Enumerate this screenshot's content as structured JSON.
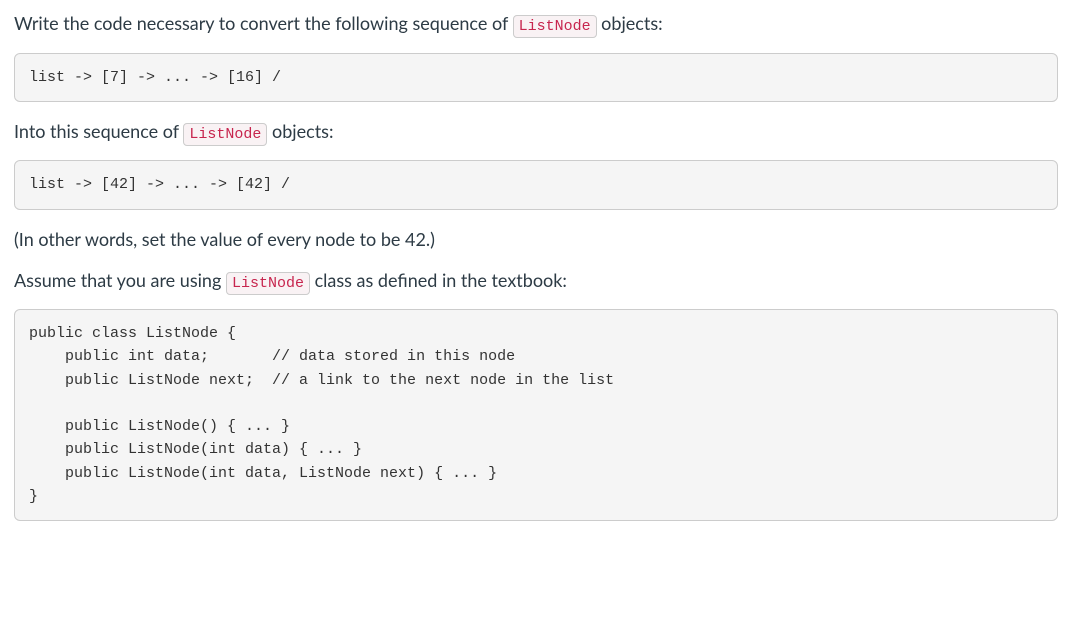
{
  "intro": {
    "part1": "Write the code necessary to convert the following sequence of ",
    "code": "ListNode",
    "part2": " objects:"
  },
  "codeblock1": "list -> [7] -> ... -> [16] /",
  "mid1": {
    "part1": "Into this sequence of ",
    "code": "ListNode",
    "part2": " objects:"
  },
  "codeblock2": "list -> [42] -> ... -> [42] /",
  "note": "(In other words, set the value of every node to be 42.)",
  "assume": {
    "part1": "Assume that you are using ",
    "code": "ListNode",
    "part2": " class as defined in the textbook:"
  },
  "classdef": "public class ListNode {\n    public int data;       // data stored in this node\n    public ListNode next;  // a link to the next node in the list\n\n    public ListNode() { ... }\n    public ListNode(int data) { ... }\n    public ListNode(int data, ListNode next) { ... }\n}"
}
